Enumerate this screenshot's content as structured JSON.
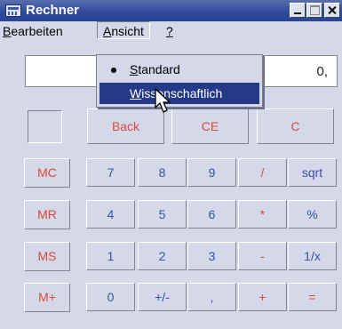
{
  "window": {
    "title": "Rechner"
  },
  "menu": {
    "bearbeiten": {
      "rest": "earbeiten",
      "accel": "B"
    },
    "ansicht": {
      "rest": "nsicht",
      "accel": "A"
    },
    "help": {
      "accel": "?"
    }
  },
  "display": {
    "value": "0,"
  },
  "view_menu": {
    "standard": {
      "accel": "S",
      "rest": "tandard",
      "checked": true
    },
    "wissenschaftlich": {
      "accel": "W",
      "rest": "issenschaftlich",
      "highlighted": true
    }
  },
  "buttons": {
    "back": "Back",
    "ce": "CE",
    "c": "C",
    "mc": "MC",
    "mr": "MR",
    "ms": "MS",
    "mplus": "M+",
    "n7": "7",
    "n8": "8",
    "n9": "9",
    "div": "/",
    "sqrt": "sqrt",
    "n4": "4",
    "n5": "5",
    "n6": "6",
    "mul": "*",
    "pct": "%",
    "n1": "1",
    "n2": "2",
    "n3": "3",
    "sub": "-",
    "inv": "1/x",
    "n0": "0",
    "sign": "+/-",
    "dot": ",",
    "add": "+",
    "eq": "="
  },
  "colors": {
    "title_bar": "#2f4a9a",
    "highlight": "#243a88",
    "digit_text": "#3a4fa8",
    "operator_text": "#d94a40",
    "face": "#D4D8E8"
  }
}
